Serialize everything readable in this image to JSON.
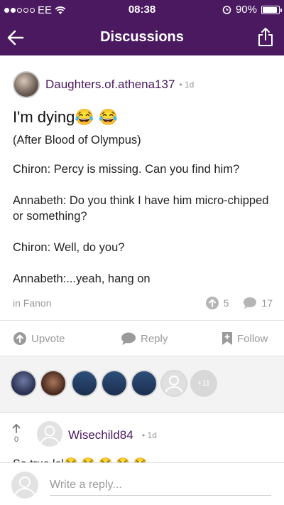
{
  "status_bar": {
    "carrier": "EE",
    "time": "08:38",
    "battery_percent": "90%",
    "battery_level": 0.9,
    "signal_bars_filled": 2,
    "signal_bars_total": 5
  },
  "nav": {
    "title": "Discussions",
    "back_icon": "arrow-left-icon",
    "share_icon": "share-icon",
    "background": "#4a1960"
  },
  "post": {
    "author": "Daughters.of.athena137",
    "time": "1d",
    "title": "I'm dying😂 😂",
    "body": [
      "(After Blood of Olympus)",
      "Chiron: Percy is missing. Can you find him?",
      "Annabeth: Do you think I have him micro-chipped or something?",
      "Chiron: Well, do you?",
      "Annabeth:...yeah, hang on"
    ],
    "category": "in Fanon",
    "upvotes": "5",
    "comments": "17"
  },
  "actions": {
    "upvote": "Upvote",
    "reply": "Reply",
    "follow": "Follow"
  },
  "voters": {
    "more_count": "+11"
  },
  "comment": {
    "votes": "0",
    "author": "Wisechild84",
    "time": "1d",
    "text": "So true lol😂 😂 😂 😂 😂"
  },
  "reply_bar": {
    "placeholder": "Write a reply..."
  },
  "colors": {
    "brand_purple": "#4a1960",
    "muted_gray": "#999999"
  }
}
